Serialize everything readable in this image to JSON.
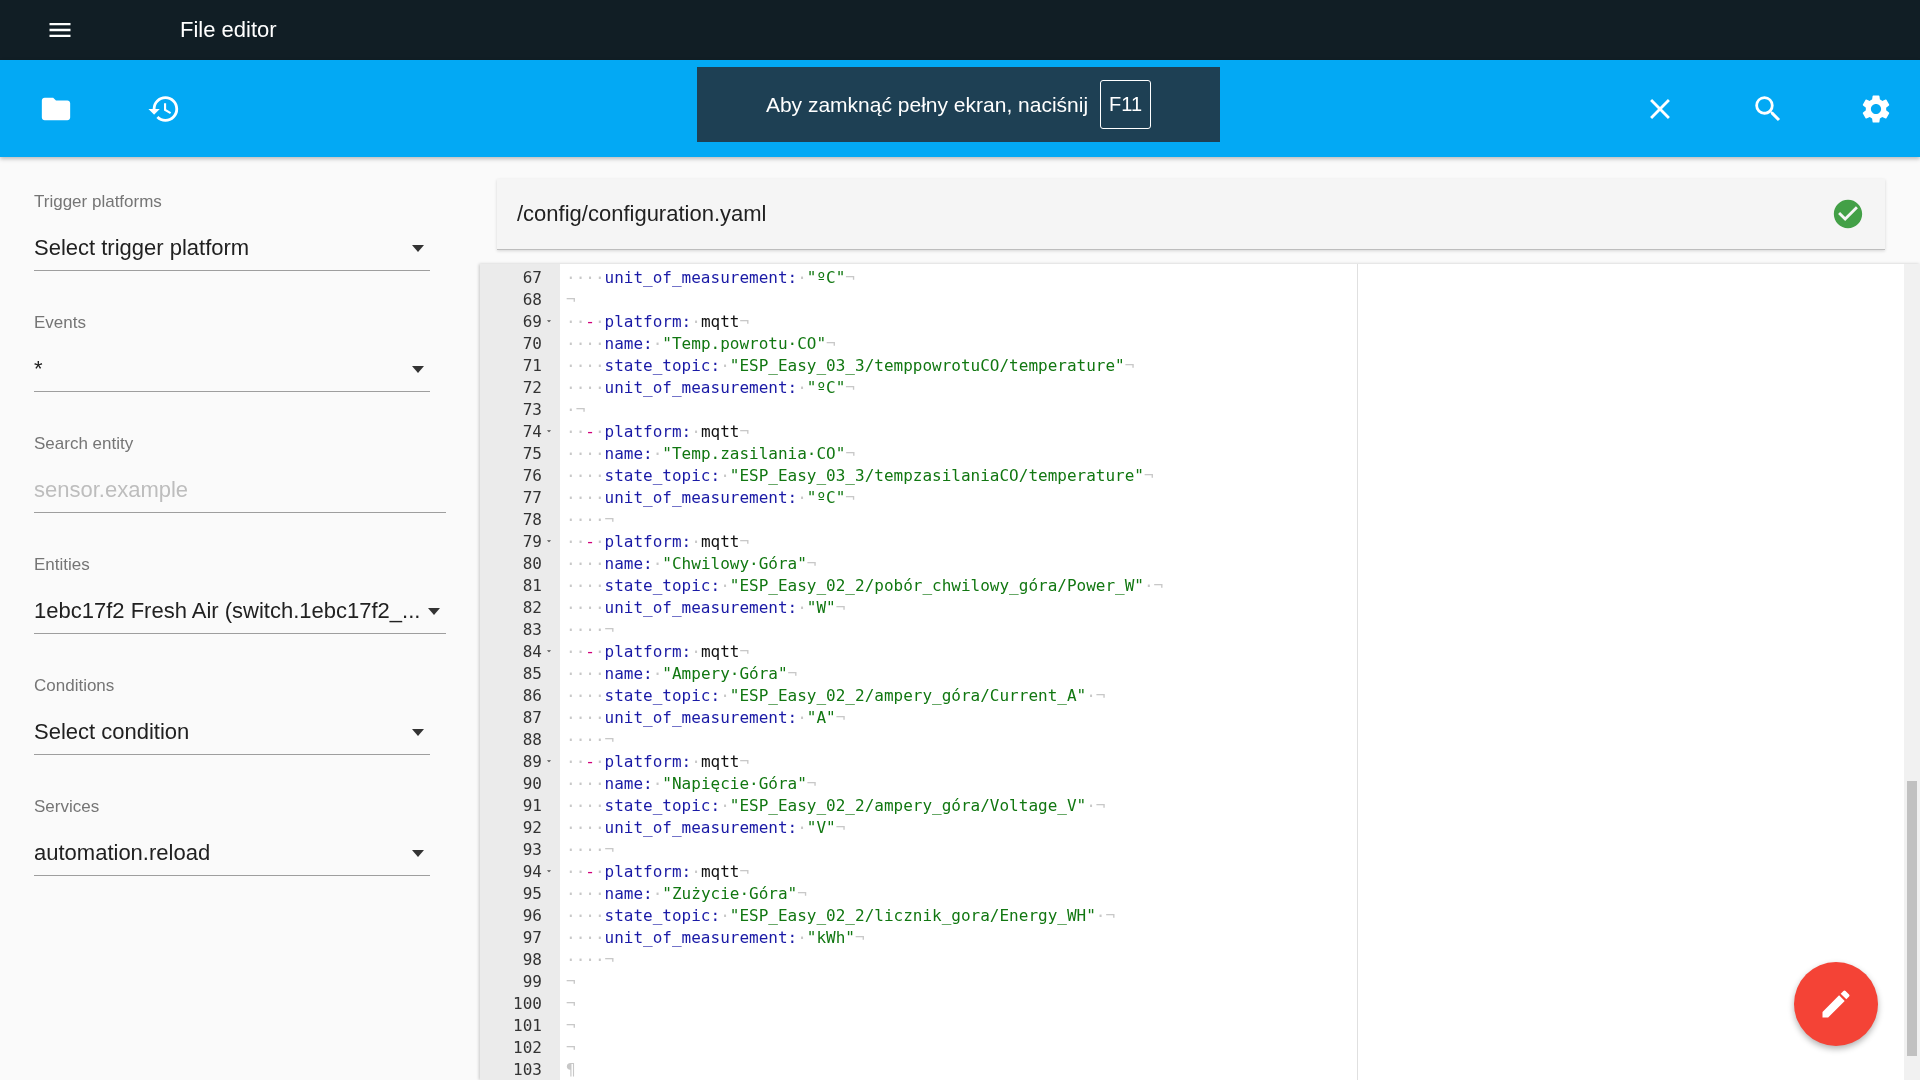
{
  "app_bar": {
    "title": "File editor"
  },
  "fullscreen_notice": {
    "text": "Aby zamknąć pełny ekran, naciśnij",
    "key": "F11"
  },
  "sidebar": {
    "fields": [
      {
        "kind": "select",
        "label": "Trigger platforms",
        "value": "Select trigger platform"
      },
      {
        "kind": "select",
        "label": "Events",
        "value": "*"
      },
      {
        "kind": "input",
        "label": "Search entity",
        "placeholder": "sensor.example"
      },
      {
        "kind": "select",
        "label": "Entities",
        "value": "1ebc17f2 Fresh Air (switch.1ebc17f2_..."
      },
      {
        "kind": "select",
        "label": "Conditions",
        "value": "Select condition"
      },
      {
        "kind": "select",
        "label": "Services",
        "value": "automation.reload"
      }
    ]
  },
  "editor": {
    "path": "/config/configuration.yaml",
    "saved": true,
    "lines": [
      {
        "number": "67",
        "foldable": false,
        "tokens": [
          {
            "kind": "ws",
            "text": "····"
          },
          {
            "kind": "key",
            "text": "unit_of_measurement:"
          },
          {
            "kind": "ws",
            "text": "·"
          },
          {
            "kind": "string",
            "text": "\"ºC\""
          },
          {
            "kind": "ws",
            "text": "¬"
          }
        ]
      },
      {
        "number": "68",
        "foldable": false,
        "tokens": [
          {
            "kind": "ws",
            "text": "¬"
          }
        ]
      },
      {
        "number": "69",
        "foldable": true,
        "tokens": [
          {
            "kind": "ws",
            "text": "··"
          },
          {
            "kind": "dash",
            "text": "-"
          },
          {
            "kind": "ws",
            "text": "·"
          },
          {
            "kind": "key",
            "text": "platform:"
          },
          {
            "kind": "ws",
            "text": "·"
          },
          {
            "kind": "plain",
            "text": "mqtt"
          },
          {
            "kind": "ws",
            "text": "¬"
          }
        ]
      },
      {
        "number": "70",
        "foldable": false,
        "tokens": [
          {
            "kind": "ws",
            "text": "····"
          },
          {
            "kind": "key",
            "text": "name:"
          },
          {
            "kind": "ws",
            "text": "·"
          },
          {
            "kind": "string",
            "text": "\"Temp.powrotu·CO\""
          },
          {
            "kind": "ws",
            "text": "¬"
          }
        ]
      },
      {
        "number": "71",
        "foldable": false,
        "tokens": [
          {
            "kind": "ws",
            "text": "····"
          },
          {
            "kind": "key",
            "text": "state_topic:"
          },
          {
            "kind": "ws",
            "text": "·"
          },
          {
            "kind": "string",
            "text": "\"ESP_Easy_03_3/temppowrotuCO/temperature\""
          },
          {
            "kind": "ws",
            "text": "¬"
          }
        ]
      },
      {
        "number": "72",
        "foldable": false,
        "tokens": [
          {
            "kind": "ws",
            "text": "····"
          },
          {
            "kind": "key",
            "text": "unit_of_measurement:"
          },
          {
            "kind": "ws",
            "text": "·"
          },
          {
            "kind": "string",
            "text": "\"ºC\""
          },
          {
            "kind": "ws",
            "text": "¬"
          }
        ]
      },
      {
        "number": "73",
        "foldable": false,
        "tokens": [
          {
            "kind": "ws",
            "text": "·¬"
          }
        ]
      },
      {
        "number": "74",
        "foldable": true,
        "tokens": [
          {
            "kind": "ws",
            "text": "··"
          },
          {
            "kind": "dash",
            "text": "-"
          },
          {
            "kind": "ws",
            "text": "·"
          },
          {
            "kind": "key",
            "text": "platform:"
          },
          {
            "kind": "ws",
            "text": "·"
          },
          {
            "kind": "plain",
            "text": "mqtt"
          },
          {
            "kind": "ws",
            "text": "¬"
          }
        ]
      },
      {
        "number": "75",
        "foldable": false,
        "tokens": [
          {
            "kind": "ws",
            "text": "····"
          },
          {
            "kind": "key",
            "text": "name:"
          },
          {
            "kind": "ws",
            "text": "·"
          },
          {
            "kind": "string",
            "text": "\"Temp.zasilania·CO\""
          },
          {
            "kind": "ws",
            "text": "¬"
          }
        ]
      },
      {
        "number": "76",
        "foldable": false,
        "tokens": [
          {
            "kind": "ws",
            "text": "····"
          },
          {
            "kind": "key",
            "text": "state_topic:"
          },
          {
            "kind": "ws",
            "text": "·"
          },
          {
            "kind": "string",
            "text": "\"ESP_Easy_03_3/tempzasilaniaCO/temperature\""
          },
          {
            "kind": "ws",
            "text": "¬"
          }
        ]
      },
      {
        "number": "77",
        "foldable": false,
        "tokens": [
          {
            "kind": "ws",
            "text": "····"
          },
          {
            "kind": "key",
            "text": "unit_of_measurement:"
          },
          {
            "kind": "ws",
            "text": "·"
          },
          {
            "kind": "string",
            "text": "\"ºC\""
          },
          {
            "kind": "ws",
            "text": "¬"
          }
        ]
      },
      {
        "number": "78",
        "foldable": false,
        "tokens": [
          {
            "kind": "ws",
            "text": "····¬"
          }
        ]
      },
      {
        "number": "79",
        "foldable": true,
        "tokens": [
          {
            "kind": "ws",
            "text": "··"
          },
          {
            "kind": "dash",
            "text": "-"
          },
          {
            "kind": "ws",
            "text": "·"
          },
          {
            "kind": "key",
            "text": "platform:"
          },
          {
            "kind": "ws",
            "text": "·"
          },
          {
            "kind": "plain",
            "text": "mqtt"
          },
          {
            "kind": "ws",
            "text": "¬"
          }
        ]
      },
      {
        "number": "80",
        "foldable": false,
        "tokens": [
          {
            "kind": "ws",
            "text": "····"
          },
          {
            "kind": "key",
            "text": "name:"
          },
          {
            "kind": "ws",
            "text": "·"
          },
          {
            "kind": "string",
            "text": "\"Chwilowy·Góra\""
          },
          {
            "kind": "ws",
            "text": "¬"
          }
        ]
      },
      {
        "number": "81",
        "foldable": false,
        "tokens": [
          {
            "kind": "ws",
            "text": "····"
          },
          {
            "kind": "key",
            "text": "state_topic:"
          },
          {
            "kind": "ws",
            "text": "·"
          },
          {
            "kind": "string",
            "text": "\"ESP_Easy_02_2/pobór_chwilowy_góra/Power_W\""
          },
          {
            "kind": "ws",
            "text": "·¬"
          }
        ]
      },
      {
        "number": "82",
        "foldable": false,
        "tokens": [
          {
            "kind": "ws",
            "text": "····"
          },
          {
            "kind": "key",
            "text": "unit_of_measurement:"
          },
          {
            "kind": "ws",
            "text": "·"
          },
          {
            "kind": "string",
            "text": "\"W\""
          },
          {
            "kind": "ws",
            "text": "¬"
          }
        ]
      },
      {
        "number": "83",
        "foldable": false,
        "tokens": [
          {
            "kind": "ws",
            "text": "····¬"
          }
        ]
      },
      {
        "number": "84",
        "foldable": true,
        "tokens": [
          {
            "kind": "ws",
            "text": "··"
          },
          {
            "kind": "dash",
            "text": "-"
          },
          {
            "kind": "ws",
            "text": "·"
          },
          {
            "kind": "key",
            "text": "platform:"
          },
          {
            "kind": "ws",
            "text": "·"
          },
          {
            "kind": "plain",
            "text": "mqtt"
          },
          {
            "kind": "ws",
            "text": "¬"
          }
        ]
      },
      {
        "number": "85",
        "foldable": false,
        "tokens": [
          {
            "kind": "ws",
            "text": "····"
          },
          {
            "kind": "key",
            "text": "name:"
          },
          {
            "kind": "ws",
            "text": "·"
          },
          {
            "kind": "string",
            "text": "\"Ampery·Góra\""
          },
          {
            "kind": "ws",
            "text": "¬"
          }
        ]
      },
      {
        "number": "86",
        "foldable": false,
        "tokens": [
          {
            "kind": "ws",
            "text": "····"
          },
          {
            "kind": "key",
            "text": "state_topic:"
          },
          {
            "kind": "ws",
            "text": "·"
          },
          {
            "kind": "string",
            "text": "\"ESP_Easy_02_2/ampery_góra/Current_A\""
          },
          {
            "kind": "ws",
            "text": "·¬"
          }
        ]
      },
      {
        "number": "87",
        "foldable": false,
        "tokens": [
          {
            "kind": "ws",
            "text": "····"
          },
          {
            "kind": "key",
            "text": "unit_of_measurement:"
          },
          {
            "kind": "ws",
            "text": "·"
          },
          {
            "kind": "string",
            "text": "\"A\""
          },
          {
            "kind": "ws",
            "text": "¬"
          }
        ]
      },
      {
        "number": "88",
        "foldable": false,
        "tokens": [
          {
            "kind": "ws",
            "text": "····¬"
          }
        ]
      },
      {
        "number": "89",
        "foldable": true,
        "tokens": [
          {
            "kind": "ws",
            "text": "··"
          },
          {
            "kind": "dash",
            "text": "-"
          },
          {
            "kind": "ws",
            "text": "·"
          },
          {
            "kind": "key",
            "text": "platform:"
          },
          {
            "kind": "ws",
            "text": "·"
          },
          {
            "kind": "plain",
            "text": "mqtt"
          },
          {
            "kind": "ws",
            "text": "¬"
          }
        ]
      },
      {
        "number": "90",
        "foldable": false,
        "tokens": [
          {
            "kind": "ws",
            "text": "····"
          },
          {
            "kind": "key",
            "text": "name:"
          },
          {
            "kind": "ws",
            "text": "·"
          },
          {
            "kind": "string",
            "text": "\"Napięcie·Góra\""
          },
          {
            "kind": "ws",
            "text": "¬"
          }
        ]
      },
      {
        "number": "91",
        "foldable": false,
        "tokens": [
          {
            "kind": "ws",
            "text": "····"
          },
          {
            "kind": "key",
            "text": "state_topic:"
          },
          {
            "kind": "ws",
            "text": "·"
          },
          {
            "kind": "string",
            "text": "\"ESP_Easy_02_2/ampery_góra/Voltage_V\""
          },
          {
            "kind": "ws",
            "text": "·¬"
          }
        ]
      },
      {
        "number": "92",
        "foldable": false,
        "tokens": [
          {
            "kind": "ws",
            "text": "····"
          },
          {
            "kind": "key",
            "text": "unit_of_measurement:"
          },
          {
            "kind": "ws",
            "text": "·"
          },
          {
            "kind": "string",
            "text": "\"V\""
          },
          {
            "kind": "ws",
            "text": "¬"
          }
        ]
      },
      {
        "number": "93",
        "foldable": false,
        "tokens": [
          {
            "kind": "ws",
            "text": "····¬"
          }
        ]
      },
      {
        "number": "94",
        "foldable": true,
        "tokens": [
          {
            "kind": "ws",
            "text": "··"
          },
          {
            "kind": "dash",
            "text": "-"
          },
          {
            "kind": "ws",
            "text": "·"
          },
          {
            "kind": "key",
            "text": "platform:"
          },
          {
            "kind": "ws",
            "text": "·"
          },
          {
            "kind": "plain",
            "text": "mqtt"
          },
          {
            "kind": "ws",
            "text": "¬"
          }
        ]
      },
      {
        "number": "95",
        "foldable": false,
        "tokens": [
          {
            "kind": "ws",
            "text": "····"
          },
          {
            "kind": "key",
            "text": "name:"
          },
          {
            "kind": "ws",
            "text": "·"
          },
          {
            "kind": "string",
            "text": "\"Zużycie·Góra\""
          },
          {
            "kind": "ws",
            "text": "¬"
          }
        ]
      },
      {
        "number": "96",
        "foldable": false,
        "tokens": [
          {
            "kind": "ws",
            "text": "····"
          },
          {
            "kind": "key",
            "text": "state_topic:"
          },
          {
            "kind": "ws",
            "text": "·"
          },
          {
            "kind": "string",
            "text": "\"ESP_Easy_02_2/licznik_gora/Energy_WH\""
          },
          {
            "kind": "ws",
            "text": "·¬"
          }
        ]
      },
      {
        "number": "97",
        "foldable": false,
        "tokens": [
          {
            "kind": "ws",
            "text": "····"
          },
          {
            "kind": "key",
            "text": "unit_of_measurement:"
          },
          {
            "kind": "ws",
            "text": "·"
          },
          {
            "kind": "string",
            "text": "\"kWh\""
          },
          {
            "kind": "ws",
            "text": "¬"
          }
        ]
      },
      {
        "number": "98",
        "foldable": false,
        "tokens": [
          {
            "kind": "ws",
            "text": "····¬"
          }
        ]
      },
      {
        "number": "99",
        "foldable": false,
        "tokens": [
          {
            "kind": "ws",
            "text": "¬"
          }
        ]
      },
      {
        "number": "100",
        "foldable": false,
        "tokens": [
          {
            "kind": "ws",
            "text": "¬"
          }
        ]
      },
      {
        "number": "101",
        "foldable": false,
        "tokens": [
          {
            "kind": "ws",
            "text": "¬"
          }
        ]
      },
      {
        "number": "102",
        "foldable": false,
        "tokens": [
          {
            "kind": "ws",
            "text": "¬"
          }
        ]
      },
      {
        "number": "103",
        "foldable": false,
        "tokens": [
          {
            "kind": "ws",
            "text": "¶"
          }
        ]
      }
    ]
  }
}
